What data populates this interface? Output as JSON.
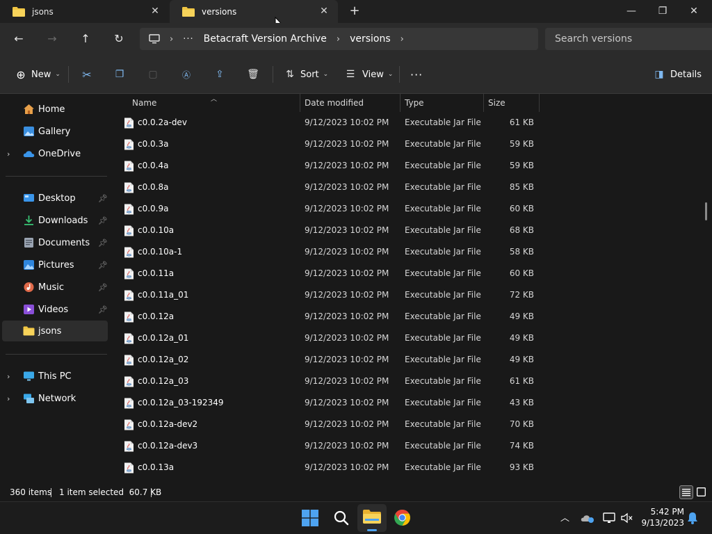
{
  "tabs": [
    {
      "label": "jsons"
    },
    {
      "label": "versions"
    }
  ],
  "address": {
    "crumbs": [
      "Betacraft Version Archive",
      "versions"
    ],
    "overflow": "···"
  },
  "search": {
    "placeholder": "Search versions"
  },
  "commands": {
    "new_label": "New",
    "sort_label": "Sort",
    "view_label": "View",
    "details_label": "Details",
    "more": "···"
  },
  "sidebar": {
    "items": [
      {
        "label": "Home",
        "icon": "home-icon"
      },
      {
        "label": "Gallery",
        "icon": "gallery-icon"
      },
      {
        "label": "OneDrive",
        "icon": "cloud-icon"
      },
      {
        "label": "Desktop",
        "icon": "desktop-icon"
      },
      {
        "label": "Downloads",
        "icon": "download-icon"
      },
      {
        "label": "Documents",
        "icon": "documents-icon"
      },
      {
        "label": "Pictures",
        "icon": "pictures-icon"
      },
      {
        "label": "Music",
        "icon": "music-icon"
      },
      {
        "label": "Videos",
        "icon": "videos-icon"
      },
      {
        "label": "jsons",
        "icon": "folder-icon"
      },
      {
        "label": "This PC",
        "icon": "pc-icon"
      },
      {
        "label": "Network",
        "icon": "network-icon"
      }
    ]
  },
  "columns": {
    "name": "Name",
    "date": "Date modified",
    "type": "Type",
    "size": "Size"
  },
  "files": [
    {
      "name": "c0.0.2a-dev",
      "date": "9/12/2023 10:02 PM",
      "type": "Executable Jar File",
      "size": "61 KB"
    },
    {
      "name": "c0.0.3a",
      "date": "9/12/2023 10:02 PM",
      "type": "Executable Jar File",
      "size": "59 KB"
    },
    {
      "name": "c0.0.4a",
      "date": "9/12/2023 10:02 PM",
      "type": "Executable Jar File",
      "size": "59 KB"
    },
    {
      "name": "c0.0.8a",
      "date": "9/12/2023 10:02 PM",
      "type": "Executable Jar File",
      "size": "85 KB"
    },
    {
      "name": "c0.0.9a",
      "date": "9/12/2023 10:02 PM",
      "type": "Executable Jar File",
      "size": "60 KB"
    },
    {
      "name": "c0.0.10a",
      "date": "9/12/2023 10:02 PM",
      "type": "Executable Jar File",
      "size": "68 KB"
    },
    {
      "name": "c0.0.10a-1",
      "date": "9/12/2023 10:02 PM",
      "type": "Executable Jar File",
      "size": "58 KB"
    },
    {
      "name": "c0.0.11a",
      "date": "9/12/2023 10:02 PM",
      "type": "Executable Jar File",
      "size": "60 KB"
    },
    {
      "name": "c0.0.11a_01",
      "date": "9/12/2023 10:02 PM",
      "type": "Executable Jar File",
      "size": "72 KB"
    },
    {
      "name": "c0.0.12a",
      "date": "9/12/2023 10:02 PM",
      "type": "Executable Jar File",
      "size": "49 KB"
    },
    {
      "name": "c0.0.12a_01",
      "date": "9/12/2023 10:02 PM",
      "type": "Executable Jar File",
      "size": "49 KB"
    },
    {
      "name": "c0.0.12a_02",
      "date": "9/12/2023 10:02 PM",
      "type": "Executable Jar File",
      "size": "49 KB"
    },
    {
      "name": "c0.0.12a_03",
      "date": "9/12/2023 10:02 PM",
      "type": "Executable Jar File",
      "size": "61 KB"
    },
    {
      "name": "c0.0.12a_03-192349",
      "date": "9/12/2023 10:02 PM",
      "type": "Executable Jar File",
      "size": "43 KB"
    },
    {
      "name": "c0.0.12a-dev2",
      "date": "9/12/2023 10:02 PM",
      "type": "Executable Jar File",
      "size": "70 KB"
    },
    {
      "name": "c0.0.12a-dev3",
      "date": "9/12/2023 10:02 PM",
      "type": "Executable Jar File",
      "size": "74 KB"
    },
    {
      "name": "c0.0.13a",
      "date": "9/12/2023 10:02 PM",
      "type": "Executable Jar File",
      "size": "93 KB"
    }
  ],
  "status": {
    "items_count": "360 items",
    "selected": "1 item selected  60.7 KB"
  },
  "clock": {
    "time": "5:42 PM",
    "date": "9/13/2023"
  },
  "colors": {
    "accent": "#4ea3f0",
    "folder": "#f0c542",
    "background": "#191919",
    "chrome": "#2b2b2b"
  }
}
